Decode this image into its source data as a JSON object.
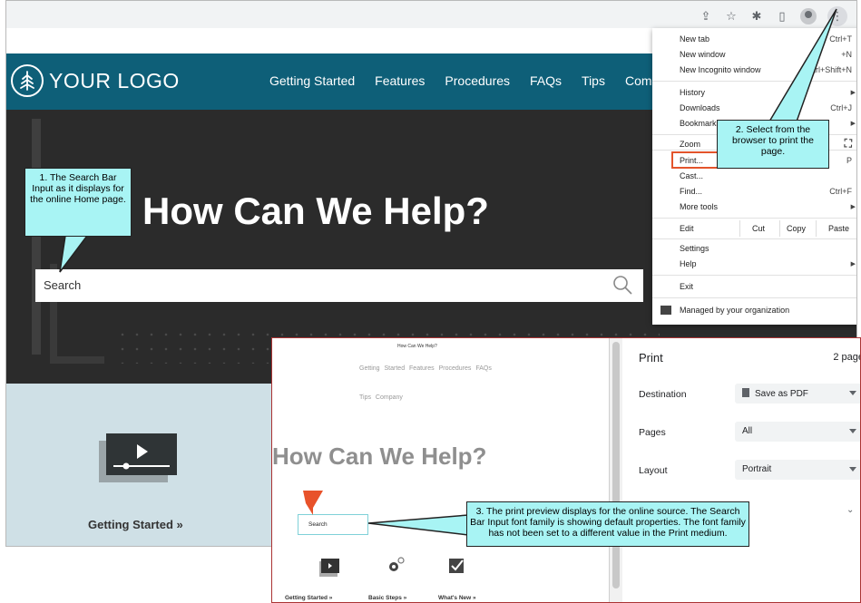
{
  "browser": {
    "toolbar_icons": [
      "share-icon",
      "star-icon",
      "extensions-icon",
      "sidepanel-icon",
      "profile-icon",
      "kebab-menu-icon"
    ]
  },
  "site": {
    "logo_text": "YOUR LOGO",
    "nav": [
      "Getting Started",
      "Features",
      "Procedures",
      "FAQs",
      "Tips",
      "Company"
    ],
    "hero_title": "How Can We Help?",
    "search_placeholder": "Search",
    "card_label": "Getting Started »"
  },
  "menu": {
    "new_tab": "New tab",
    "new_tab_key": "Ctrl+T",
    "new_window": "New window",
    "new_window_key": "+N",
    "new_incognito": "New Incognito window",
    "new_incognito_key": "Ctrl+Shift+N",
    "history": "History",
    "downloads": "Downloads",
    "downloads_key": "Ctrl+J",
    "bookmarks": "Bookmarks",
    "zoom": "Zoom",
    "print": "Print...",
    "print_key": "P",
    "cast": "Cast...",
    "find": "Find...",
    "find_key": "Ctrl+F",
    "more_tools": "More tools",
    "edit": "Edit",
    "cut": "Cut",
    "copy": "Copy",
    "paste": "Paste",
    "settings": "Settings",
    "help": "Help",
    "exit": "Exit",
    "managed": "Managed by your organization"
  },
  "callouts": {
    "c1": "1. The Search Bar Input as it displays for the online Home page.",
    "c2": "2. Select from the browser to print the page.",
    "c3": "3. The print preview displays for the online source. The Search Bar Input font family is showing default properties. The font family has not been set to a different value in the Print medium."
  },
  "preview": {
    "small_title": "How Can We Help?",
    "nav_line1": "Getting Started  Features  Procedures  FAQs",
    "nav_line2": "Tips  Company",
    "title": "How Can We Help?",
    "search_text": "Search",
    "labels": [
      "Getting Started »",
      "Basic Steps »",
      "What's New »"
    ]
  },
  "print_settings": {
    "title": "Print",
    "pages_count": "2 page",
    "destination_label": "Destination",
    "destination_value": "Save as PDF",
    "pages_label": "Pages",
    "pages_value": "All",
    "layout_label": "Layout",
    "layout_value": "Portrait"
  },
  "colors": {
    "header_teal": "#0e5f78",
    "hero_dark": "#2b2b2b",
    "callout_fill": "#a8f4f4",
    "highlight_red": "#e3542b"
  }
}
